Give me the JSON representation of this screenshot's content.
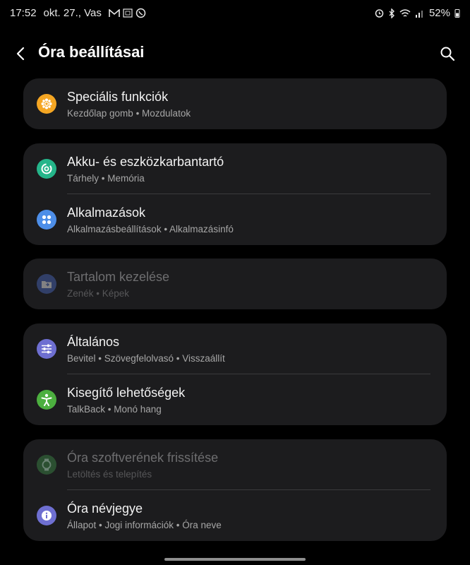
{
  "status": {
    "time": "17:52",
    "date": "okt. 27., Vas",
    "battery": "52%"
  },
  "header": {
    "title": "Óra beállításai"
  },
  "cards": [
    {
      "items": [
        {
          "label": "Speciális funkciók",
          "sub": "Kezdőlap gomb • Mozdulatok",
          "icon": "gear-flower-icon",
          "color": "#f5a623"
        }
      ]
    },
    {
      "items": [
        {
          "label": "Akku- és eszközkarbantartó",
          "sub": "Tárhely • Memória",
          "icon": "device-care-icon",
          "color": "#25b58a"
        },
        {
          "label": "Alkalmazások",
          "sub": "Alkalmazásbeállítások • Alkalmazásinfó",
          "icon": "apps-grid-icon",
          "color": "#4d8ee8"
        }
      ]
    },
    {
      "items": [
        {
          "label": "Tartalom kezelése",
          "sub": "Zenék • Képek",
          "icon": "folder-icon",
          "color": "#4d6bc4",
          "disabled": true
        }
      ]
    },
    {
      "items": [
        {
          "label": "Általános",
          "sub": "Bevitel • Szövegfelolvasó • Visszaállít",
          "icon": "sliders-icon",
          "color": "#6e6fd1"
        },
        {
          "label": "Kisegítő lehetőségek",
          "sub": "TalkBack • Monó hang",
          "icon": "accessibility-icon",
          "color": "#4caf3f"
        }
      ]
    },
    {
      "items": [
        {
          "label": "Óra szoftverének frissítése",
          "sub": "Letöltés és telepítés",
          "icon": "watch-update-icon",
          "color": "#3f8e4a",
          "disabled": true
        },
        {
          "label": "Óra névjegye",
          "sub": "Állapot • Jogi információk • Óra neve",
          "icon": "info-icon",
          "color": "#6e6fd1"
        }
      ]
    }
  ]
}
